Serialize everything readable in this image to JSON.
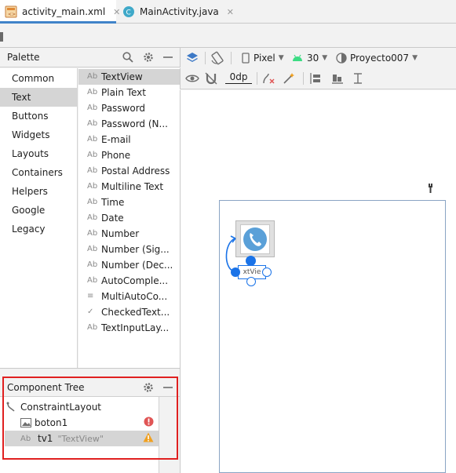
{
  "tabs": [
    {
      "label": "activity_main.xml",
      "icon": "xml-layout-icon",
      "active": true
    },
    {
      "label": "MainActivity.java",
      "icon": "java-class-icon",
      "active": false
    }
  ],
  "palette": {
    "title": "Palette",
    "categories": [
      "Common",
      "Text",
      "Buttons",
      "Widgets",
      "Layouts",
      "Containers",
      "Helpers",
      "Google",
      "Legacy"
    ],
    "selected_category": "Text",
    "items": [
      {
        "icon": "Ab",
        "label": "TextView"
      },
      {
        "icon": "Ab",
        "label": "Plain Text"
      },
      {
        "icon": "Ab",
        "label": "Password"
      },
      {
        "icon": "Ab",
        "label": "Password (N..."
      },
      {
        "icon": "Ab",
        "label": "E-mail"
      },
      {
        "icon": "Ab",
        "label": "Phone"
      },
      {
        "icon": "Ab",
        "label": "Postal Address"
      },
      {
        "icon": "Ab",
        "label": "Multiline Text"
      },
      {
        "icon": "Ab",
        "label": "Time"
      },
      {
        "icon": "Ab",
        "label": "Date"
      },
      {
        "icon": "Ab",
        "label": "Number"
      },
      {
        "icon": "Ab",
        "label": "Number (Sig..."
      },
      {
        "icon": "Ab",
        "label": "Number (Dec..."
      },
      {
        "icon": "Ab",
        "label": "AutoComple..."
      },
      {
        "icon": "≡",
        "label": "MultiAutoCo..."
      },
      {
        "icon": "✓",
        "label": "CheckedText..."
      },
      {
        "icon": "Ab",
        "label": "TextInputLay..."
      }
    ],
    "selected_item": "TextView"
  },
  "component_tree": {
    "title": "Component Tree",
    "rows": [
      {
        "label": "ConstraintLayout",
        "icon": "constraint-layout-icon",
        "secondary": "",
        "status": ""
      },
      {
        "label": "boton1",
        "icon": "image-button-icon",
        "secondary": "",
        "status": "error"
      },
      {
        "label": "tv1",
        "icon": "Ab",
        "secondary": "\"TextView\"",
        "status": "warning"
      }
    ]
  },
  "toolbar": {
    "device": "Pixel",
    "api": "30",
    "theme": "Proyecto007",
    "margin": "0dp"
  },
  "design": {
    "textview_label": "xtVie"
  },
  "colors": {
    "accent": "#4083c9",
    "error": "#e05555",
    "warning": "#f0a020",
    "highlight_box": "#e02020",
    "selection": "#1a73e8"
  }
}
